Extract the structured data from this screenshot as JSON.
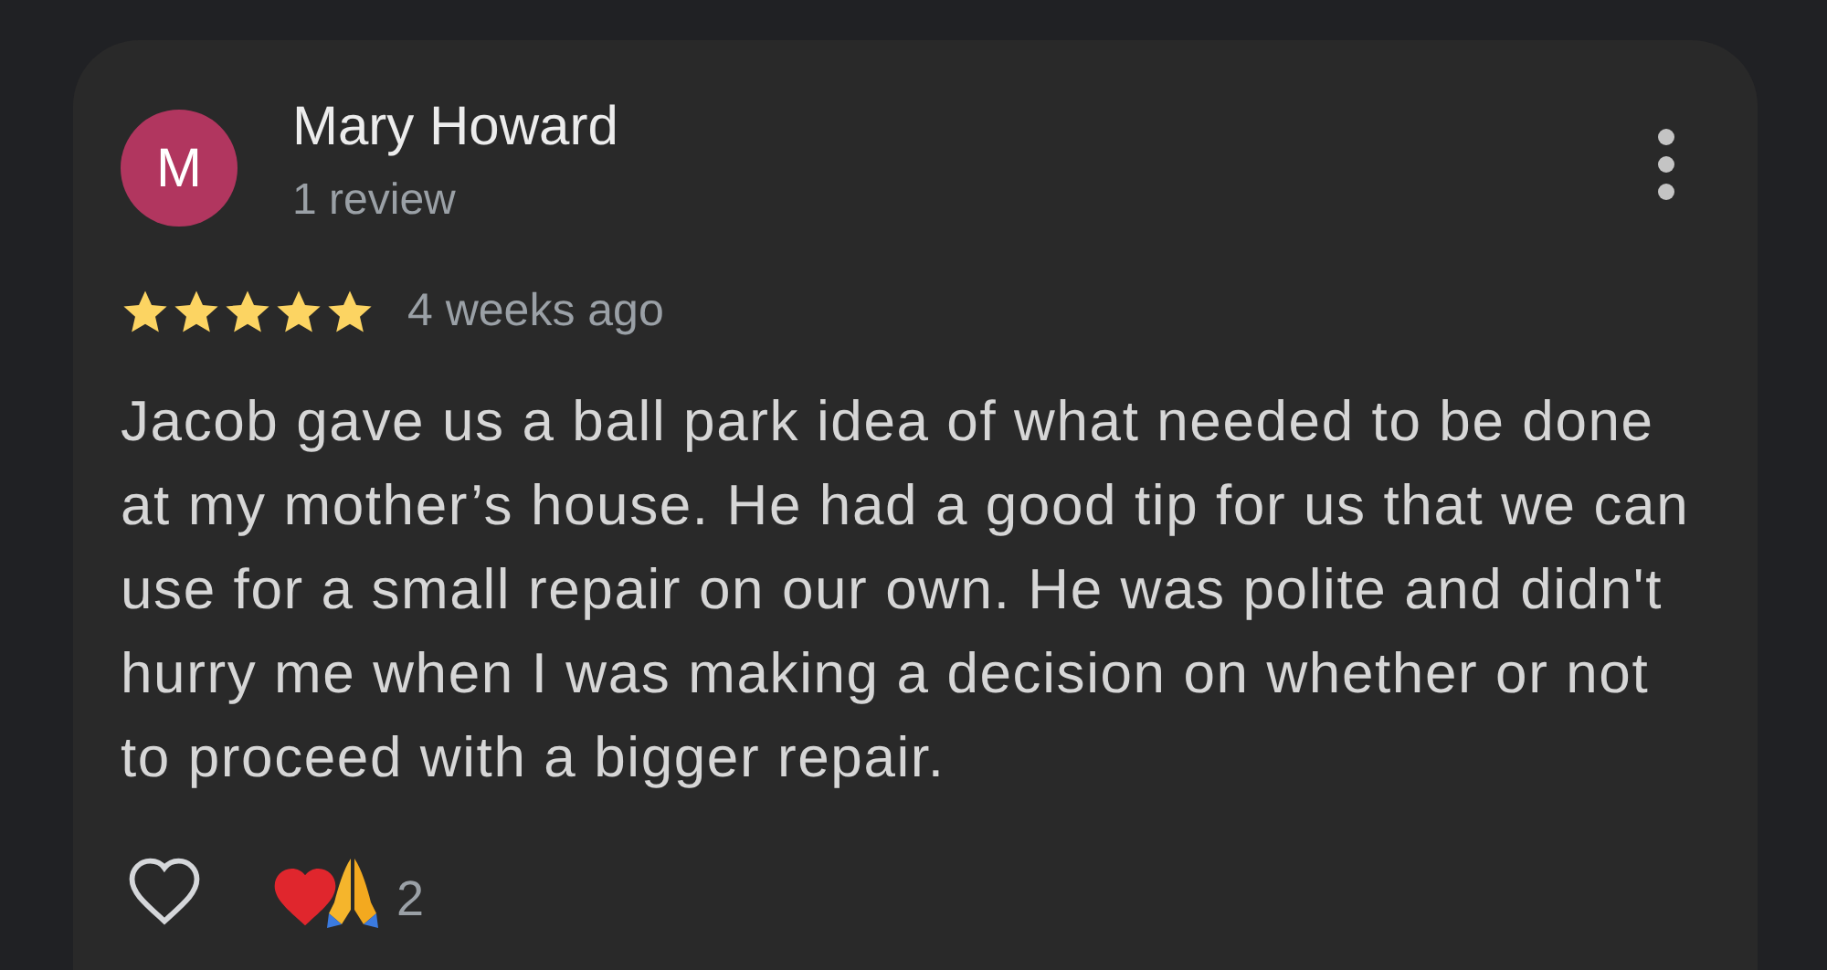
{
  "review": {
    "avatar_letter": "M",
    "author": "Mary Howard",
    "author_meta": "1 review",
    "stars": 5,
    "time": "4 weeks ago",
    "text": "Jacob gave us a ball park idea of what needed to be done at my mother’s house. He had a good tip for us that we can use for a small repair on our own. He was polite and didn't hurry me when I was making a decision on whether or not to proceed with a bigger repair.",
    "liked": false,
    "reaction_count": "2"
  }
}
